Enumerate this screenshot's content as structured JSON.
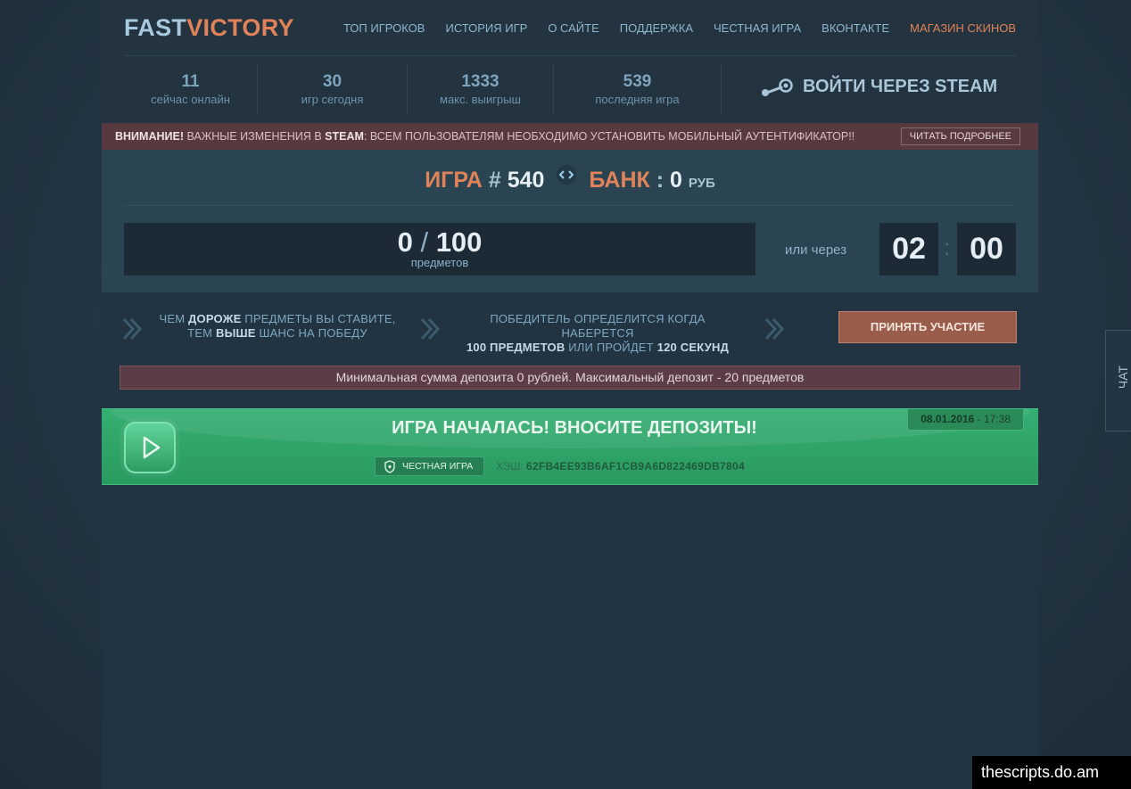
{
  "header": {
    "logo_part1": "FAST",
    "logo_part2": "VICTORY",
    "nav": [
      {
        "label": "ТОП ИГРОКОВ"
      },
      {
        "label": "ИСТОРИЯ ИГР"
      },
      {
        "label": "О САЙТЕ"
      },
      {
        "label": "ПОДДЕРЖКА"
      },
      {
        "label": "ЧЕСТНАЯ ИГРА"
      },
      {
        "label": "ВКОНТАКТЕ"
      },
      {
        "label": "МАГАЗИН СКИНОВ"
      }
    ],
    "stats": [
      {
        "value": "11",
        "label": "сейчас онлайн"
      },
      {
        "value": "30",
        "label": "игр сегодня"
      },
      {
        "value": "1333",
        "label": "макс. выигрыш"
      },
      {
        "value": "539",
        "label": "последняя игра"
      }
    ],
    "steam_login": "ВОЙТИ ЧЕРЕЗ STEAM"
  },
  "alert": {
    "prefix": "ВНИМАНИЕ!",
    "text1": " ВАЖНЫЕ ИЗМЕНЕНИЯ В ",
    "steam": "STEAM",
    "text2": ": ВСЕМ ПОЛЬЗОВАТЕЛЯМ НЕОБХОДИМО УСТАНОВИТЬ МОБИЛЬНЫЙ АУТЕНТИФИКАТОР!!",
    "more": "ЧИТАТЬ ПОДРОБНЕЕ"
  },
  "game": {
    "game_label": "ИГРА",
    "hash_sign": "#",
    "number": "540",
    "bank_label": "БАНК",
    "bank_colon": ":",
    "bank_value": "0",
    "currency": "РУБ",
    "items_current": "0",
    "items_separator": "/",
    "items_max": "100",
    "items_label": "предметов",
    "or_via": "или через",
    "timer_min": "02",
    "timer_colon": ":",
    "timer_sec": "00"
  },
  "info": {
    "tip1_a": "ЧЕМ ",
    "tip1_b": "ДОРОЖЕ",
    "tip1_c": " ПРЕДМЕТЫ ВЫ СТАВИТЕ,",
    "tip1_d": "ТЕМ ",
    "tip1_e": "ВЫШЕ",
    "tip1_f": " ШАНС НА ПОБЕДУ",
    "tip2_a": "ПОБЕДИТЕЛЬ ОПРЕДЕЛИТСЯ КОГДА НАБЕРЕТСЯ",
    "tip2_b": "100 ПРЕДМЕТОВ",
    "tip2_c": " ИЛИ ПРОЙДЕТ ",
    "tip2_d": "120 СЕКУНД",
    "join": "ПРИНЯТЬ УЧАСТИЕ",
    "limits": "Минимальная сумма депозита 0 рублей. Максимальный депозит - 20 предметов"
  },
  "started": {
    "title": "ИГРА НАЧАЛАСЬ! ВНОСИТЕ ДЕПОЗИТЫ!",
    "fair_label": "ЧЕСТНАЯ ИГРА",
    "hash_label": "ХЭШ: ",
    "hash_value": "62FB4EE93B6AF1CB9A6D822469DB7804",
    "date": "08.01.2016",
    "time_sep": " - ",
    "time": "17:38"
  },
  "chat_label": "ЧАТ",
  "watermark": "thescripts.do.am",
  "colors": {
    "accent": "#e0835a",
    "panel": "#2a4452",
    "success": "#35ae72",
    "alert": "#58393f"
  }
}
